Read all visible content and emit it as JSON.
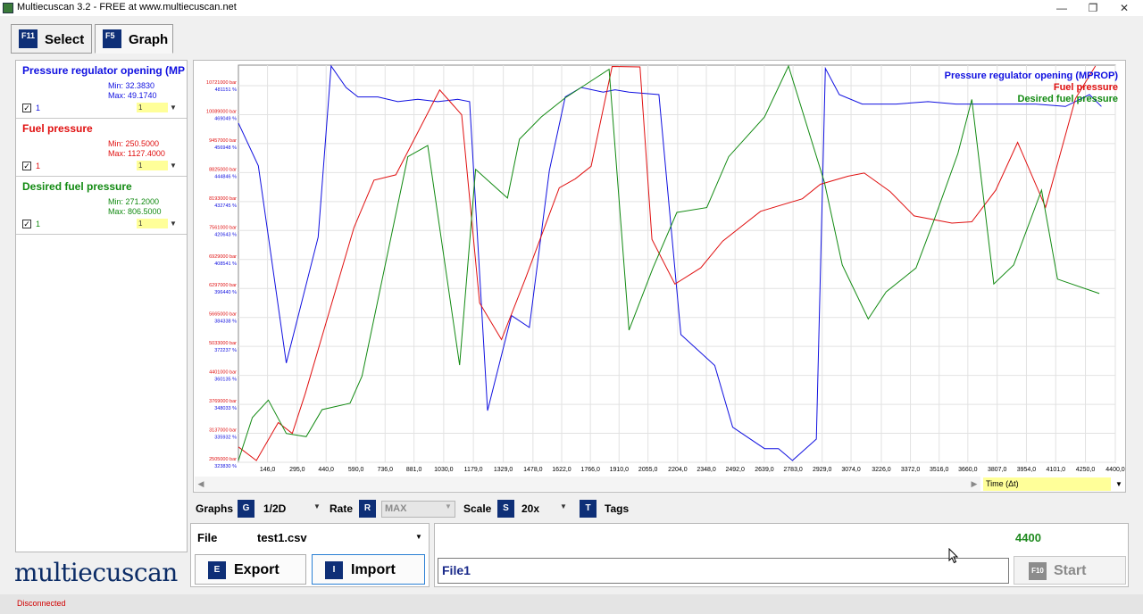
{
  "window": {
    "title": "Multiecuscan 3.2 - FREE at www.multiecuscan.net",
    "minimize": "—",
    "maximize": "❐",
    "close": "✕"
  },
  "tabs": [
    {
      "key": "F11",
      "label": "Select"
    },
    {
      "key": "F5",
      "label": "Graph"
    }
  ],
  "signals": [
    {
      "name": "Pressure regulator opening (MP",
      "min": "Min: 32.3830",
      "max": "Max: 49.1740",
      "checked": true,
      "index": "1",
      "scale": "1",
      "color": "#1010e0"
    },
    {
      "name": "Fuel pressure",
      "min": "Min: 250.5000",
      "max": "Max: 1127.4000",
      "checked": true,
      "index": "1",
      "scale": "1",
      "color": "#e01010"
    },
    {
      "name": "Desired fuel pressure",
      "min": "Min: 271.2000",
      "max": "Max: 806.5000",
      "checked": true,
      "index": "1",
      "scale": "1",
      "color": "#128a12"
    }
  ],
  "logo": "multiecuscan",
  "chart_data": {
    "type": "line",
    "xlabel": "Time (Δt)",
    "x_ticks": [
      "146,0",
      "295,0",
      "440,0",
      "590,0",
      "736,0",
      "881,0",
      "1030,0",
      "1179,0",
      "1329,0",
      "1478,0",
      "1622,0",
      "1766,0",
      "1910,0",
      "2055,0",
      "2204,0",
      "2348,0",
      "2492,0",
      "2639,0",
      "2783,0",
      "2929,0",
      "3074,0",
      "3226,0",
      "3372,0",
      "3516,0",
      "3660,0",
      "3807,0",
      "3954,0",
      "4101,0",
      "4250,0",
      "4400,0"
    ],
    "xlim": [
      0,
      4400
    ],
    "y_ticks_red": [
      "10721000 bar",
      "10089000 bar",
      "9457000 bar",
      "8825000 bar",
      "8193000 bar",
      "7561000 bar",
      "6929000 bar",
      "6297000 bar",
      "5665000 bar",
      "5033000 bar",
      "4401000 bar",
      "3769000 bar",
      "3137000 bar",
      "2505000 bar"
    ],
    "y_ticks_blue": [
      "481151 %",
      "469049 %",
      "456948 %",
      "444846 %",
      "432745 %",
      "420643 %",
      "408541 %",
      "396440 %",
      "384338 %",
      "372237 %",
      "360135 %",
      "348033 %",
      "335932 %",
      "323830 %"
    ],
    "legend": [
      {
        "name": "Pressure regulator opening (MPROP)",
        "color": "#1010e0"
      },
      {
        "name": "Fuel pressure",
        "color": "#e01010"
      },
      {
        "name": "Desired fuel pressure",
        "color": "#128a12"
      }
    ],
    "series": [
      {
        "name": "Pressure regulator opening (MPROP)",
        "color": "#1010e0",
        "x": [
          0,
          100,
          240,
          400,
          465,
          540,
          600,
          700,
          800,
          900,
          1000,
          1100,
          1160,
          1250,
          1370,
          1460,
          1560,
          1640,
          1720,
          1830,
          1890,
          1960,
          2110,
          2220,
          2390,
          2480,
          2640,
          2710,
          2780,
          2900,
          2945,
          3015,
          3130,
          3300,
          3460,
          3600,
          3700,
          3850,
          4000,
          4150,
          4270,
          4330
        ],
        "values": [
          46.6,
          44.8,
          36.5,
          41.8,
          49.0,
          48.1,
          47.7,
          47.7,
          47.5,
          47.6,
          47.5,
          47.6,
          47.5,
          34.5,
          38.5,
          38.0,
          44.6,
          47.7,
          48.1,
          47.9,
          48.0,
          47.9,
          47.8,
          37.7,
          36.4,
          33.8,
          32.9,
          32.9,
          32.4,
          33.3,
          48.9,
          47.8,
          47.4,
          47.4,
          47.5,
          47.4,
          47.4,
          47.4,
          47.4,
          47.3,
          47.8,
          47.3
        ]
      },
      {
        "name": "Fuel pressure",
        "color": "#e01010",
        "x": [
          0,
          90,
          200,
          270,
          335,
          580,
          680,
          790,
          1010,
          1120,
          1210,
          1320,
          1440,
          1610,
          1690,
          1770,
          1875,
          2015,
          2075,
          2190,
          2320,
          2430,
          2620,
          2830,
          2920,
          3060,
          3140,
          3270,
          3390,
          3580,
          3680,
          3800,
          3910,
          4050,
          4200,
          4300
        ],
        "values": [
          283,
          253,
          337,
          313,
          401,
          769,
          874,
          886,
          1074,
          1019,
          602,
          521,
          656,
          857,
          877,
          905,
          1126,
          1125,
          743,
          644,
          680,
          739,
          805,
          833,
          865,
          883,
          890,
          849,
          795,
          779,
          782,
          852,
          958,
          814,
          1055,
          1127
        ]
      },
      {
        "name": "Desired fuel pressure",
        "color": "#128a12",
        "x": [
          0,
          70,
          150,
          240,
          340,
          420,
          560,
          620,
          850,
          950,
          1110,
          1190,
          1350,
          1410,
          1520,
          1640,
          1860,
          1960,
          2080,
          2200,
          2350,
          2460,
          2640,
          2760,
          2940,
          3030,
          3160,
          3250,
          3400,
          3490,
          3610,
          3680,
          3790,
          3890,
          4030,
          4110,
          4320
        ],
        "values": [
          286,
          313,
          324,
          303,
          301,
          318,
          322,
          339,
          477,
          484,
          346,
          469,
          451,
          488,
          502,
          514,
          532,
          368,
          407,
          442,
          445,
          477,
          502,
          534,
          461,
          409,
          375,
          392,
          407,
          437,
          479,
          513,
          397,
          409,
          456,
          400,
          391
        ]
      }
    ]
  },
  "controls": {
    "graphs_label": "Graphs",
    "graphs_key": "G",
    "graphs_value": "1/2D",
    "rate_label": "Rate",
    "rate_key": "R",
    "rate_value": "MAX",
    "scale_label": "Scale",
    "scale_key": "S",
    "scale_value": "20x",
    "tags_label": "Tags",
    "tags_key": "T"
  },
  "file": {
    "label": "File",
    "value": "test1.csv"
  },
  "buttons": {
    "export_key": "E",
    "export_label": "Export",
    "import_key": "I",
    "import_label": "Import",
    "start_key": "F10",
    "start_label": "Start"
  },
  "log": {
    "counter": "4400",
    "file_value": "File1"
  },
  "status": "Disconnected",
  "colors": {
    "accent": "#0e2f77",
    "highlight": "#ffff99"
  }
}
